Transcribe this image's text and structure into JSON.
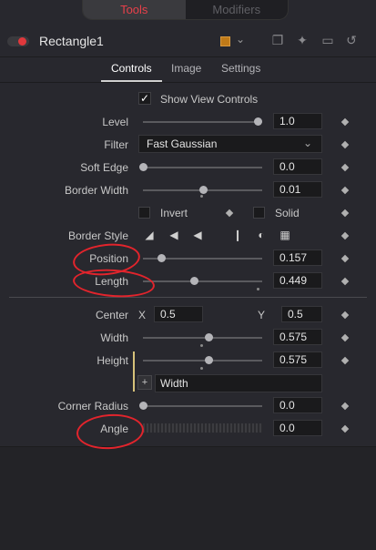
{
  "top_tabs": [
    "Tools",
    "Modifiers"
  ],
  "node": {
    "title": "Rectangle1",
    "color": "#c07a18"
  },
  "sub_tabs": [
    "Controls",
    "Image",
    "Settings"
  ],
  "show_view_controls": {
    "label": "Show View Controls",
    "checked": true
  },
  "controls": {
    "level": {
      "label": "Level",
      "value": "1.0"
    },
    "filter": {
      "label": "Filter",
      "value": "Fast Gaussian"
    },
    "soft_edge": {
      "label": "Soft Edge",
      "value": "0.0"
    },
    "border_width": {
      "label": "Border Width",
      "value": "0.01"
    },
    "invert": {
      "label": "Invert",
      "checked": false
    },
    "solid": {
      "label": "Solid",
      "checked": false
    },
    "border_style": {
      "label": "Border Style"
    },
    "position": {
      "label": "Position",
      "value": "0.157"
    },
    "length": {
      "label": "Length",
      "value": "0.449"
    },
    "center": {
      "label": "Center",
      "x_label": "X",
      "x_value": "0.5",
      "y_label": "Y",
      "y_value": "0.5"
    },
    "width": {
      "label": "Width",
      "value": "0.575"
    },
    "height": {
      "label": "Height",
      "value": "0.575"
    },
    "link": {
      "value": "Width"
    },
    "corner_radius": {
      "label": "Corner Radius",
      "value": "0.0"
    },
    "angle": {
      "label": "Angle",
      "value": "0.0"
    }
  },
  "annotation_color": "#e2242c"
}
